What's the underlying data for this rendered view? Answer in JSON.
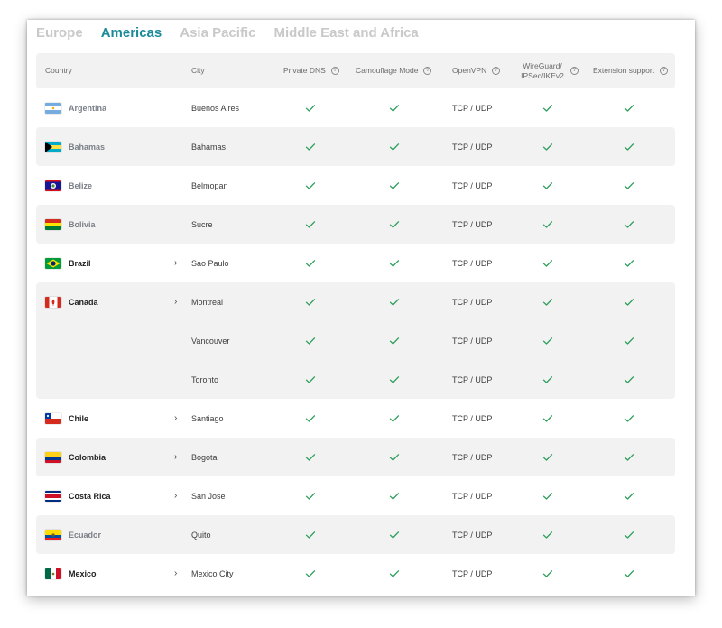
{
  "tabs": [
    {
      "label": "Europe",
      "active": false
    },
    {
      "label": "Americas",
      "active": true
    },
    {
      "label": "Asia Pacific",
      "active": false
    },
    {
      "label": "Middle East and Africa",
      "active": false
    }
  ],
  "columns": {
    "country": "Country",
    "city": "City",
    "private_dns": "Private DNS",
    "camouflage": "Camouflage Mode",
    "openvpn": "OpenVPN",
    "wireguard": "WireGuard/ IPSec/IKEv2",
    "extension": "Extension support"
  },
  "colors": {
    "accent": "#1a8a99",
    "check": "#2e9e5c",
    "tab_inactive": "#c9c9c9"
  },
  "rows": [
    {
      "country": "Argentina",
      "flag": "flag-argentina",
      "city": "Buenos Aires",
      "openvpn": "TCP / UDP",
      "expandable": false
    },
    {
      "country": "Bahamas",
      "flag": "flag-bahamas",
      "city": "Bahamas",
      "openvpn": "TCP / UDP",
      "expandable": false
    },
    {
      "country": "Belize",
      "flag": "flag-belize",
      "city": "Belmopan",
      "openvpn": "TCP / UDP",
      "expandable": false
    },
    {
      "country": "Bolivia",
      "flag": "flag-bolivia",
      "city": "Sucre",
      "openvpn": "TCP / UDP",
      "expandable": false
    },
    {
      "country": "Brazil",
      "flag": "flag-brazil",
      "city": "Sao Paulo",
      "openvpn": "TCP / UDP",
      "expandable": true
    },
    {
      "country": "Canada",
      "flag": "flag-canada",
      "city": "Montreal",
      "openvpn": "TCP / UDP",
      "expandable": true
    },
    {
      "country": "",
      "flag": "",
      "city": "Vancouver",
      "openvpn": "TCP / UDP",
      "expandable": false
    },
    {
      "country": "",
      "flag": "",
      "city": "Toronto",
      "openvpn": "TCP / UDP",
      "expandable": false
    },
    {
      "country": "Chile",
      "flag": "flag-chile",
      "city": "Santiago",
      "openvpn": "TCP / UDP",
      "expandable": true
    },
    {
      "country": "Colombia",
      "flag": "flag-colombia",
      "city": "Bogota",
      "openvpn": "TCP / UDP",
      "expandable": true
    },
    {
      "country": "Costa Rica",
      "flag": "flag-costa-rica",
      "city": "San Jose",
      "openvpn": "TCP / UDP",
      "expandable": true
    },
    {
      "country": "Ecuador",
      "flag": "flag-ecuador",
      "city": "Quito",
      "openvpn": "TCP / UDP",
      "expandable": false
    },
    {
      "country": "Mexico",
      "flag": "flag-mexico",
      "city": "Mexico City",
      "openvpn": "TCP / UDP",
      "expandable": true
    }
  ]
}
